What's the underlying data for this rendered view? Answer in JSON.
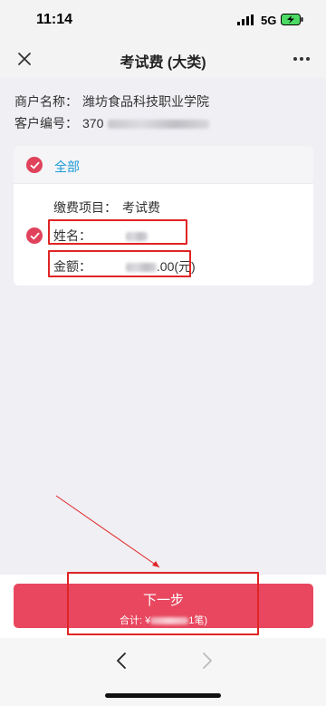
{
  "status_bar": {
    "time": "11:14",
    "network": "5G",
    "icons": [
      "signal-icon",
      "battery-charging-icon"
    ]
  },
  "nav": {
    "title": "考试费 (大类)",
    "close_icon": "close-icon",
    "more_icon": "more-icon"
  },
  "merchant": {
    "name_key": "商户名称：",
    "name_value": "潍坊食品科技职业学院",
    "customer_key": "客户编号：",
    "customer_prefix": "370"
  },
  "card": {
    "all_label": "全部",
    "fee_item_key": "缴费项目：",
    "fee_item_value": "考试费",
    "name_key": "姓名：",
    "amount_key": "金额：",
    "amount_suffix": ".00(元)"
  },
  "footer": {
    "next_label": "下一步",
    "total_prefix": "合计: ¥",
    "total_suffix": "1笔)"
  },
  "colors": {
    "accent": "#e8475f",
    "check": "#e0425c",
    "link_blue": "#1b9ad6",
    "highlight_red": "#e02424"
  }
}
